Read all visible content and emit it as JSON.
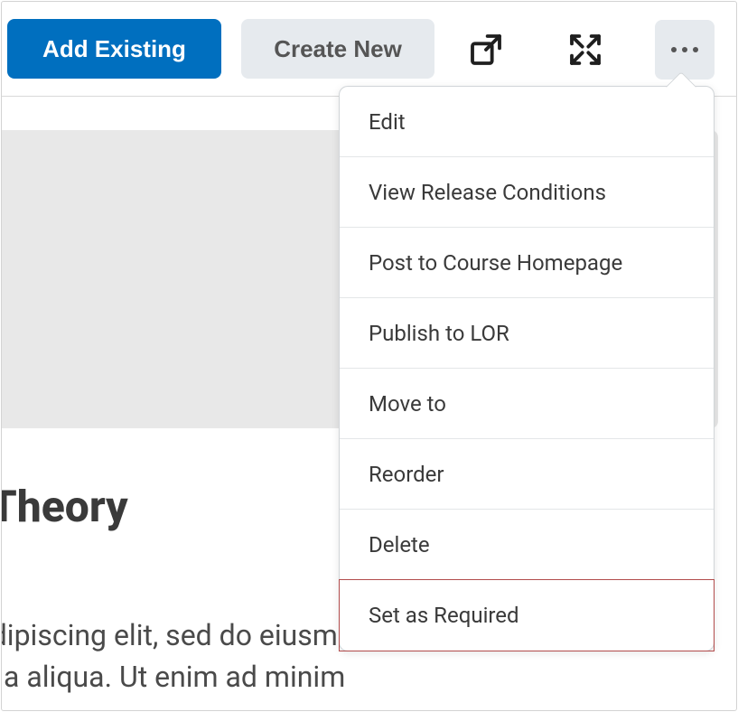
{
  "toolbar": {
    "add_existing_label": "Add Existing",
    "create_new_label": "Create New"
  },
  "content": {
    "title_visible": "ang Theory",
    "body_line1": "tetur adipiscing elit, sed do eiusmod tempor",
    "body_line2": "e magna aliqua. Ut enim ad minim"
  },
  "menu": {
    "items": [
      {
        "label": "Edit"
      },
      {
        "label": "View Release Conditions"
      },
      {
        "label": "Post to Course Homepage"
      },
      {
        "label": "Publish to LOR"
      },
      {
        "label": "Move to"
      },
      {
        "label": "Reorder"
      },
      {
        "label": "Delete"
      },
      {
        "label": "Set as Required",
        "highlight": true
      }
    ]
  }
}
